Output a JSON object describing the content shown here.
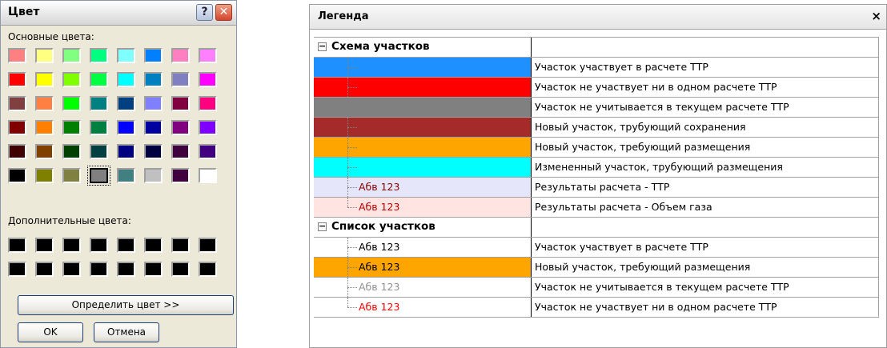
{
  "color_dialog": {
    "title": "Цвет",
    "help_label": "?",
    "close_label": "✕",
    "basic_colors_label": "Основные цвета:",
    "custom_colors_label": "Дополнительные цвета:",
    "basic_colors": [
      "#ff8080",
      "#ffff80",
      "#80ff80",
      "#00ff80",
      "#80ffff",
      "#0080ff",
      "#ff80c0",
      "#ff80ff",
      "#ff0000",
      "#ffff00",
      "#80ff00",
      "#00ff40",
      "#00ffff",
      "#0080c0",
      "#8080c0",
      "#ff00ff",
      "#804040",
      "#ff8040",
      "#00ff00",
      "#008080",
      "#004080",
      "#8080ff",
      "#800040",
      "#ff0080",
      "#800000",
      "#ff8000",
      "#008000",
      "#008040",
      "#0000ff",
      "#0000a0",
      "#800080",
      "#8000ff",
      "#400000",
      "#804000",
      "#004000",
      "#004040",
      "#000080",
      "#000040",
      "#400040",
      "#400080",
      "#000000",
      "#808000",
      "#808040",
      "#808080",
      "#408080",
      "#c0c0c0",
      "#400040",
      "#ffffff"
    ],
    "selected_index": 43,
    "custom_colors": [
      "#000000",
      "#000000",
      "#000000",
      "#000000",
      "#000000",
      "#000000",
      "#000000",
      "#000000",
      "#000000",
      "#000000",
      "#000000",
      "#000000",
      "#000000",
      "#000000",
      "#000000",
      "#000000"
    ],
    "define_color_label": "Определить цвет >>",
    "ok_label": "OK",
    "cancel_label": "Отмена"
  },
  "legend": {
    "title": "Легенда",
    "close_label": "×",
    "rows": [
      {
        "kind": "group",
        "expander": "−",
        "label": "Схема участков",
        "desc": ""
      },
      {
        "kind": "item",
        "bg": "#1e90ff",
        "text": "",
        "text_color": "#000000",
        "desc": "Участок участвует в расчете ТТР"
      },
      {
        "kind": "item",
        "bg": "#ff0000",
        "text": "",
        "text_color": "#000000",
        "desc": "Участок не участвует ни в одном расчете ТТР"
      },
      {
        "kind": "item",
        "bg": "#808080",
        "text": "",
        "text_color": "#000000",
        "desc": "Участок не учитывается в текущем расчете ТТР"
      },
      {
        "kind": "item",
        "bg": "#a52a2a",
        "text": "",
        "text_color": "#000000",
        "desc": "Новый участок, трубующий сохранения"
      },
      {
        "kind": "item",
        "bg": "#ffa500",
        "text": "",
        "text_color": "#000000",
        "desc": "Новый участок, требующий размещения"
      },
      {
        "kind": "item",
        "bg": "#00ffff",
        "text": "",
        "text_color": "#000000",
        "desc": "Измененный участок, трубующий размещения"
      },
      {
        "kind": "item",
        "bg": "#e6e6fa",
        "text": "Абв 123",
        "text_color": "#8b0000",
        "desc": "Результаты расчета - ТТР"
      },
      {
        "kind": "item",
        "bg": "#ffe4e1",
        "text": "Абв 123",
        "text_color": "#c00000",
        "desc": "Результаты  расчета - Объем газа",
        "last": true
      },
      {
        "kind": "group",
        "expander": "−",
        "label": "Список участков",
        "desc": ""
      },
      {
        "kind": "item",
        "bg": "#ffffff",
        "text": "Абв 123",
        "text_color": "#000000",
        "desc": "Участок участвует в расчете ТТР"
      },
      {
        "kind": "item",
        "bg": "#ffa500",
        "text": "Абв 123",
        "text_color": "#000000",
        "desc": "Новый участок, требующий размещения"
      },
      {
        "kind": "item",
        "bg": "#ffffff",
        "text": "Абв 123",
        "text_color": "#909090",
        "desc": "Участок не учитывается в текущем расчете ТТР"
      },
      {
        "kind": "item",
        "bg": "#ffffff",
        "text": "Абв 123",
        "text_color": "#ff0000",
        "desc": "Участок не участвует ни в одном расчете ТТР",
        "last": true
      }
    ]
  }
}
